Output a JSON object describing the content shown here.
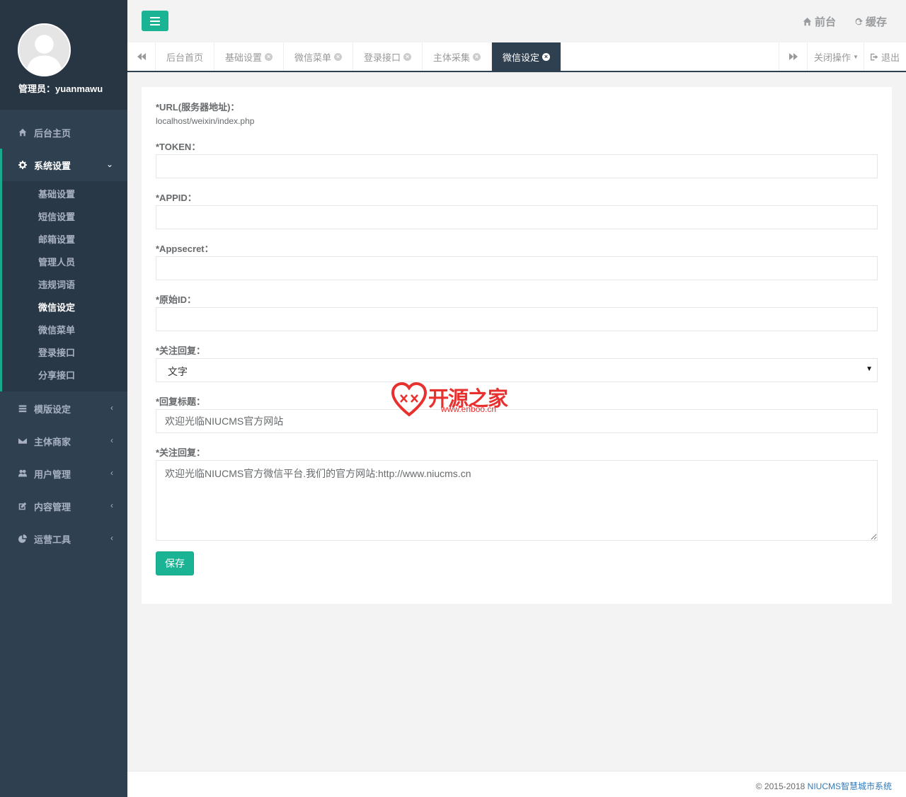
{
  "sidebar": {
    "admin_label": "管理员：yuanmawu",
    "items": [
      {
        "label": "后台主页",
        "icon": "home-icon"
      },
      {
        "label": "系统设置",
        "icon": "gear-icon"
      },
      {
        "label": "模版设定",
        "icon": "template-icon"
      },
      {
        "label": "主体商家",
        "icon": "envelope-icon"
      },
      {
        "label": "用户管理",
        "icon": "users-icon"
      },
      {
        "label": "内容管理",
        "icon": "edit-icon"
      },
      {
        "label": "运营工具",
        "icon": "pie-chart-icon"
      }
    ],
    "sub_items": [
      "基础设置",
      "短信设置",
      "邮箱设置",
      "管理人员",
      "违规词语",
      "微信设定",
      "微信菜单",
      "登录接口",
      "分享接口"
    ]
  },
  "topbar": {
    "frontend_label": "前台",
    "cache_label": "缓存"
  },
  "tabs": {
    "items": [
      "后台首页",
      "基础设置",
      "微信菜单",
      "登录接口",
      "主体采集",
      "微信设定"
    ],
    "close_ops_label": "关闭操作",
    "logout_label": "退出"
  },
  "form": {
    "url_label": "*URL(服务器地址)：",
    "url_value": "localhost/weixin/index.php",
    "token_label": "*TOKEN：",
    "appid_label": "*APPID：",
    "appsecret_label": "*Appsecret：",
    "origin_id_label": "*原始ID：",
    "follow_reply_label": "*关注回复：",
    "follow_reply_type": "文字",
    "reply_title_label": "*回复标题：",
    "reply_title_value": "欢迎光临NIUCMS官方网站",
    "follow_reply_content_label": "*关注回复：",
    "follow_reply_content": "欢迎光临NIUCMS官方微信平台.我们的官方网站:http://www.niucms.cn",
    "save_label": "保存"
  },
  "watermark": {
    "text": "开源之家",
    "url": "www.enboo.cn"
  },
  "footer": {
    "copyright": "© 2015-2018 ",
    "brand": "NIUCMS智慧城市系统"
  },
  "colors": {
    "sidebar_bg": "#2f4050",
    "accent": "#1ab394",
    "watermark": "#e8312f"
  }
}
